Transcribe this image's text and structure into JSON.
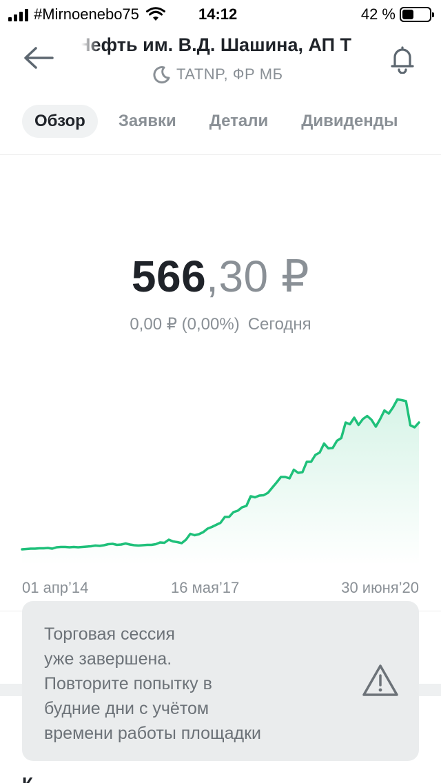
{
  "status_bar": {
    "carrier": "#Mirnoenebo75",
    "time": "14:12",
    "battery_percent": "42 %",
    "battery_level": 0.42,
    "signal_icon": "signal-bars-icon",
    "wifi_icon": "wifi-icon"
  },
  "header": {
    "title": "Нефть им. В.Д. Шашина, АП Т",
    "ticker": "TATNP, ФР МБ",
    "back_icon": "arrow-left-icon",
    "session_icon": "moon-icon",
    "bell_icon": "bell-icon"
  },
  "tabs": [
    {
      "label": "Обзор",
      "active": true
    },
    {
      "label": "Заявки",
      "active": false
    },
    {
      "label": "Детали",
      "active": false
    },
    {
      "label": "Дивиденды",
      "active": false
    }
  ],
  "price": {
    "integer": "566",
    "fraction": ",30 ₽",
    "change": "0,00 ₽ (0,00%)",
    "period": "Сегодня"
  },
  "chart_data": {
    "type": "area",
    "x_labels": [
      "01 апр’14",
      "16 мая’17",
      "30 июня’20"
    ],
    "values": [
      2,
      3,
      4,
      4,
      5,
      5,
      6,
      4,
      8,
      9,
      9,
      8,
      9,
      8,
      9,
      10,
      11,
      13,
      12,
      14,
      17,
      18,
      15,
      16,
      19,
      16,
      14,
      13,
      14,
      15,
      15,
      17,
      22,
      21,
      30,
      25,
      23,
      20,
      30,
      47,
      43,
      46,
      52,
      62,
      67,
      73,
      79,
      96,
      96,
      110,
      114,
      124,
      128,
      156,
      153,
      158,
      159,
      166,
      181,
      196,
      212,
      212,
      208,
      233,
      224,
      226,
      256,
      256,
      276,
      283,
      309,
      295,
      296,
      317,
      325,
      370,
      365,
      384,
      363,
      380,
      389,
      378,
      358,
      380,
      405,
      396,
      414,
      437,
      435,
      432,
      362,
      356,
      370
    ],
    "ylim": [
      0,
      440
    ],
    "line_color": "#1fc07a"
  },
  "notice": {
    "lines": [
      "Торговая сессия",
      "уже завершена.",
      "Повторите попытку в",
      "будние дни с учётом",
      "времени работы площадки"
    ],
    "icon": "warning-triangle-icon"
  },
  "bottom": {
    "stub": "К"
  }
}
